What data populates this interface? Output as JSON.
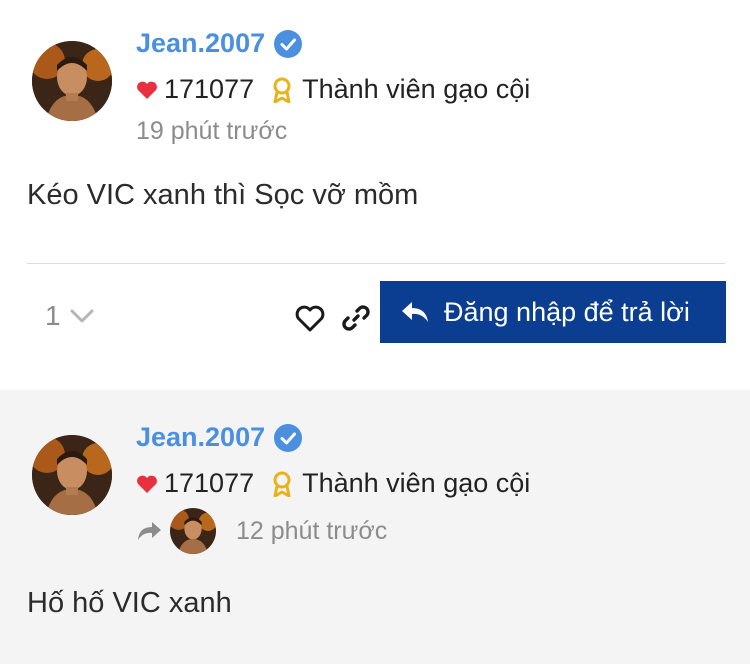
{
  "posts": [
    {
      "username": "Jean.2007",
      "score": "171077",
      "rank": "Thành viên gạo cội",
      "time": "19 phút trước",
      "content": "Kéo VIC xanh thì Sọc vỡ mồm",
      "votes": "1",
      "reply_label": "Đăng nhập để trả lời"
    },
    {
      "username": "Jean.2007",
      "score": "171077",
      "rank": "Thành viên gạo cội",
      "time": "12 phút trước",
      "content": "Hố hố VIC xanh"
    }
  ],
  "icons": {
    "verified": "verified-check-icon",
    "heart": "heart-icon",
    "badge": "ribbon-badge-icon",
    "chevron": "chevron-down-icon",
    "like": "heart-outline-icon",
    "link": "link-icon",
    "reply": "reply-arrow-icon"
  },
  "colors": {
    "username": "#4a8fe0",
    "button_bg": "#0b3e91",
    "heart": "#e8303f",
    "badge": "#e8b21c",
    "muted": "#8c8c8c"
  }
}
